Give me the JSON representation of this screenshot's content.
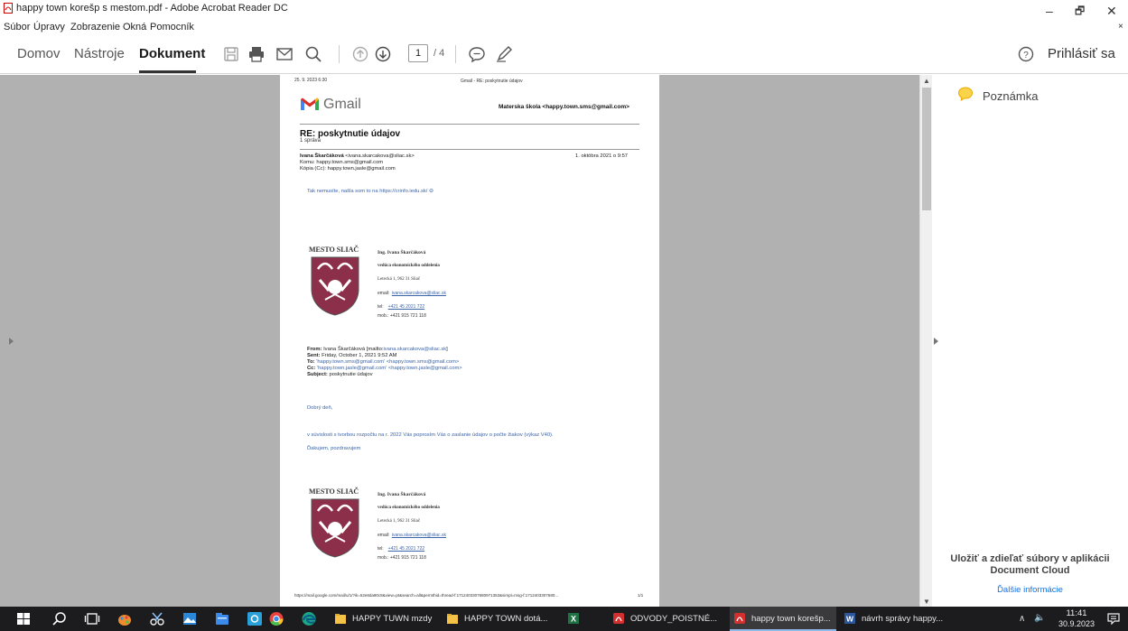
{
  "window": {
    "title": "happy town korešp s mestom.pdf - Adobe Acrobat Reader DC",
    "minimize": "–",
    "maximize": "🗗",
    "close": "✕"
  },
  "menubar": {
    "items": [
      "Súbor",
      "Úpravy",
      "Zobrazenie",
      "Okná",
      "Pomocník"
    ],
    "close": "×"
  },
  "toolbar": {
    "tabs": [
      "Domov",
      "Nástroje",
      "Dokument"
    ],
    "active_tab": "Dokument",
    "page_current": "1",
    "page_total": "/ 4",
    "signin": "Prihlásiť sa"
  },
  "pdf": {
    "header_date": "25. 9. 2023 6:30",
    "header_title": "Gmail - RE: poskytnutie údajov",
    "gmail_word": "Gmail",
    "sender_account": "Materska škola <happy.town.sms@gmail.com>",
    "subject": "RE: poskytnutie údajov",
    "message_count": "1 správa",
    "from_name": "Ivana Škarčáková",
    "from_email": "<ivana.skarcakova@sliac.sk>",
    "date_sent": "1. októbra 2021 o 9:57",
    "to_line": "Komu: happy.town.sms@gmail.com",
    "cc_line": "Kópia (Cc): happy.town.jasle@gmail.com",
    "reply_text": "Tak nemusíte, našla som to na",
    "reply_link": "https://crinfo.iedu.sk/",
    "signature": {
      "mesto": "MESTO SLIAČ",
      "name": "Ing. Ivana Škarčáková",
      "dept": "vedúca ekonomického oddelenia",
      "address": "Letecká 1, 962 31 Sliač",
      "email_label": "email:",
      "email": "ivana.skarcakova@sliac.sk",
      "tel_label": "tel:",
      "tel": "+421 45 2021 722",
      "mob_label": "mob.:",
      "mob": "+421 915 721 118"
    },
    "quoted": {
      "from_label": "From:",
      "from_value": "Ivana Škarčáková [mailto:",
      "from_link": "ivana.skarcakova@sliac.sk",
      "from_end": "]",
      "sent_label": "Sent:",
      "sent_value": "Friday, October 1, 2021 9:52 AM",
      "to_label": "To:",
      "to_value": "'happy.town.sms@gmail.com' <happy.town.sms@gmail.com>",
      "cc_label": "Cc:",
      "cc_value": "'happy.town.jasle@gmail.com' <happy.town.jasle@gmail.com>",
      "subject_label": "Subject:",
      "subject_value": "poskytnutie údajov"
    },
    "greeting": "Dobrý deň,",
    "body": "v súvislosti s tvorbou rozpočtu na r. 2022 Vás poprosím Vás o zaslanie údajov o počte žiakov (výkaz V40).",
    "thanks": "Ďakujem, pozdravujem",
    "footer_url": "https://mail.google.com/mail/u/1/?ik=52e8da90c8&view=pt&search=all&permthid=thread-f:1712403307680971353&simpl=msg-f:17124033076​80...",
    "footer_page": "1/1"
  },
  "right_panel": {
    "note_label": "Poznámka",
    "promo_line1": "Uložiť a zdieľať súbory v aplikácii",
    "promo_line2": "Document Cloud",
    "promo_link": "Ďalšie informácie"
  },
  "scrollbar": {
    "up": "▲",
    "down": "▼"
  },
  "taskbar": {
    "tasks": [
      {
        "label": "HAPPY TUWN mzdy",
        "icon": "folder-icon"
      },
      {
        "label": "HAPPY TOWN dotá...",
        "icon": "folder-icon"
      },
      {
        "label": "",
        "icon": "excel-icon"
      },
      {
        "label": "ODVODY_POISTNÉ...",
        "icon": "pdf-icon"
      },
      {
        "label": "happy town korešp...",
        "icon": "pdf-icon"
      },
      {
        "label": "návrh správy happy...",
        "icon": "word-icon"
      }
    ],
    "tray_chevron": "∧",
    "tray_volume": "🔈",
    "time": "11:41",
    "date": "30.9.2023"
  },
  "colors": {
    "accent_link": "#1473e6",
    "doc_background": "#b1b1b1",
    "taskbar": "#1c1c1e",
    "gmail_red": "#d93025",
    "crest": "#8c2f4a"
  }
}
